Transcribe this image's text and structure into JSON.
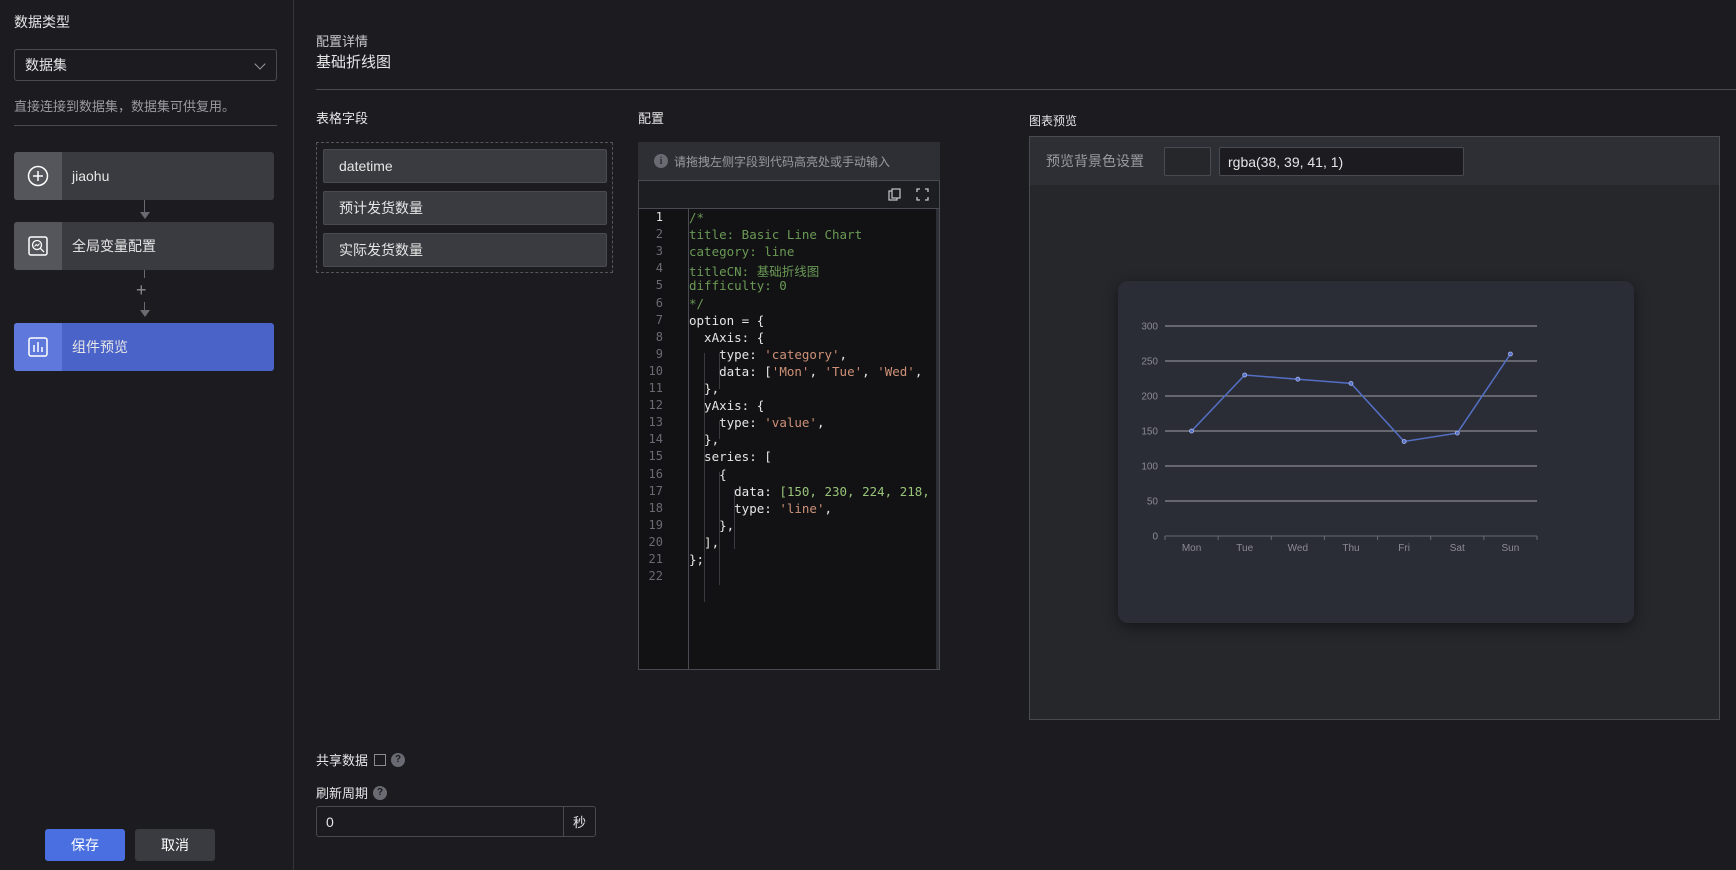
{
  "sidebar": {
    "section_title": "数据类型",
    "select_value": "数据集",
    "hint": "直接连接到数据集，数据集可供复用。",
    "nodes": [
      {
        "label": "jiaohu",
        "icon": "plus-circle-icon"
      },
      {
        "label": "全局变量配置",
        "icon": "search-chart-icon"
      },
      {
        "label": "组件预览",
        "icon": "chart-icon"
      }
    ],
    "save_label": "保存",
    "cancel_label": "取消"
  },
  "main": {
    "subtitle": "配置详情",
    "title": "基础折线图",
    "fields_title": "表格字段",
    "fields": [
      "datetime",
      "预计发货数量",
      "实际发货数量"
    ],
    "config_title": "配置",
    "config_tip": "请拖拽左侧字段到代码高亮处或手动输入",
    "preview_title": "图表预览",
    "bg_label": "预览背景色设置",
    "bg_value": "rgba(38, 39, 41, 1)",
    "share_label": "共享数据",
    "refresh_label": "刷新周期",
    "refresh_value": "0",
    "refresh_unit": "秒"
  },
  "code": {
    "lines": [
      "/*",
      "title: Basic Line Chart",
      "category: line",
      "titleCN: 基础折线图",
      "difficulty: 0",
      "*/",
      "option = {",
      "  xAxis: {",
      "    type: 'category',",
      "    data: ['Mon', 'Tue', 'Wed',",
      "  },",
      "  yAxis: {",
      "    type: 'value',",
      "  },",
      "  series: [",
      "    {",
      "      data: [150, 230, 224, 218,",
      "      type: 'line',",
      "    },",
      "  ],",
      "};",
      ""
    ]
  },
  "colors": {
    "accent": "#4a6fe0",
    "active_node": "#4a63c8",
    "series_line": "#5470c6"
  },
  "chart_data": {
    "type": "line",
    "categories": [
      "Mon",
      "Tue",
      "Wed",
      "Thu",
      "Fri",
      "Sat",
      "Sun"
    ],
    "values": [
      150,
      230,
      224,
      218,
      135,
      147,
      260
    ],
    "yticks": [
      0,
      50,
      100,
      150,
      200,
      250,
      300
    ],
    "ylim": [
      0,
      300
    ],
    "grid": true
  }
}
